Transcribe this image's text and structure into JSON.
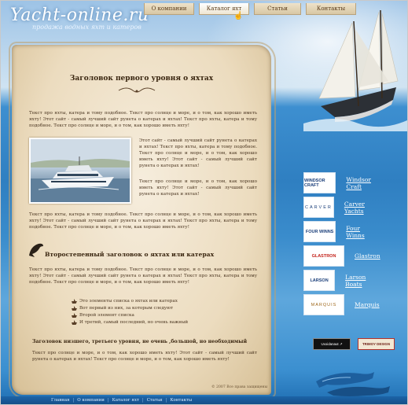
{
  "site": {
    "logo_title": "Yacht-online.ru",
    "logo_slogan": "продажа водных яхт и катеров"
  },
  "nav": [
    {
      "label": "О компании"
    },
    {
      "label": "Каталог яхт"
    },
    {
      "label": "Статьи"
    },
    {
      "label": "Контакты"
    }
  ],
  "content": {
    "h1": "Заголовок первого уровня о яхтах",
    "p1": "Текст про яхты, катера и тому подобное. Текст про солнце и море, и о том, как хорошо иметь яхту! Этот сайт - самый лучший сайт рунета о катерах и яхтах! Текст про яхты, катера и тому подобное. Текст про солнце и море, и о том, как хорошо иметь яхту!",
    "p2": "Этот сайт - самый лучший сайт рунета о катерах и яхтах! Текст про яхты, катера и тому подобное. Текст про солнце и море, и о том, как хорошо иметь яхту! Этот сайт - самый лучший сайт рунета о катерах и яхтах!",
    "p3": "Текст про солнце и море, и о том, как хорошо иметь яхту! Этот сайт - самый лучший сайт рунета о катерах и яхтах!",
    "p4": "Текст про яхты, катера и тому подобное. Текст про солнце и море, и о том, как хорошо иметь яхту! Этот сайт - самый лучший сайт рунета о катерах и яхтах! Текст про яхты, катера и тому подобное. Текст про солнце и море, и о том, как хорошо иметь яхту!",
    "h2": "Второстепенный заголовок о яхтах или катерах",
    "p5": "Текст про яхты, катера и тому подобное. Текст про солнце и море, и о том, как хорошо иметь яхту! Этот сайт - самый лучший сайт рунета о катерах и яхтах! Текст про яхты, катера и тому подобное. Текст про солнце и море, и о том, как хорошо иметь яхту!",
    "list": [
      "Это элементы списка о яхтах или катерах",
      "Вот первый из них, за которым следуют",
      "Второй элемент списка",
      "И третий, самый последний, но очень важный"
    ],
    "h3": "Заголовок низшего, третьего уровня, не очень ,большой, но необходимый",
    "p6": "Текст про солнце и море, и о том, как хорошо иметь яхту! Этот сайт - самый лучший сайт рунета о катерах и яхтах! Текст про солнце и море, и о том, как хорошо иметь яхту!",
    "copyright": "© 2007 Все права защищены"
  },
  "partners": [
    {
      "logo": "WINDSOR CRAFT",
      "name": "Windsor Craft"
    },
    {
      "logo": "CARVER",
      "name": "Carver Yachts"
    },
    {
      "logo": "FOUR WINNS",
      "name": "Four Winns"
    },
    {
      "logo": "GLASTRON",
      "name": "Glastron"
    },
    {
      "logo": "LARSON",
      "name": "Larson Boats"
    },
    {
      "logo": "MARQUIS",
      "name": "Marquis"
    }
  ],
  "badges": {
    "left": "Uxoidanaut ↗",
    "right": "TRIMOY DESIGN"
  },
  "footer": [
    {
      "label": "Главная"
    },
    {
      "label": "О компании"
    },
    {
      "label": "Каталог яхт"
    },
    {
      "label": "Статьи"
    },
    {
      "label": "Контакты"
    }
  ],
  "colors": {
    "paper": "#ecdcbf",
    "heading": "#3a2610",
    "sea": "#2f7fc1",
    "link": "#ffffff"
  }
}
